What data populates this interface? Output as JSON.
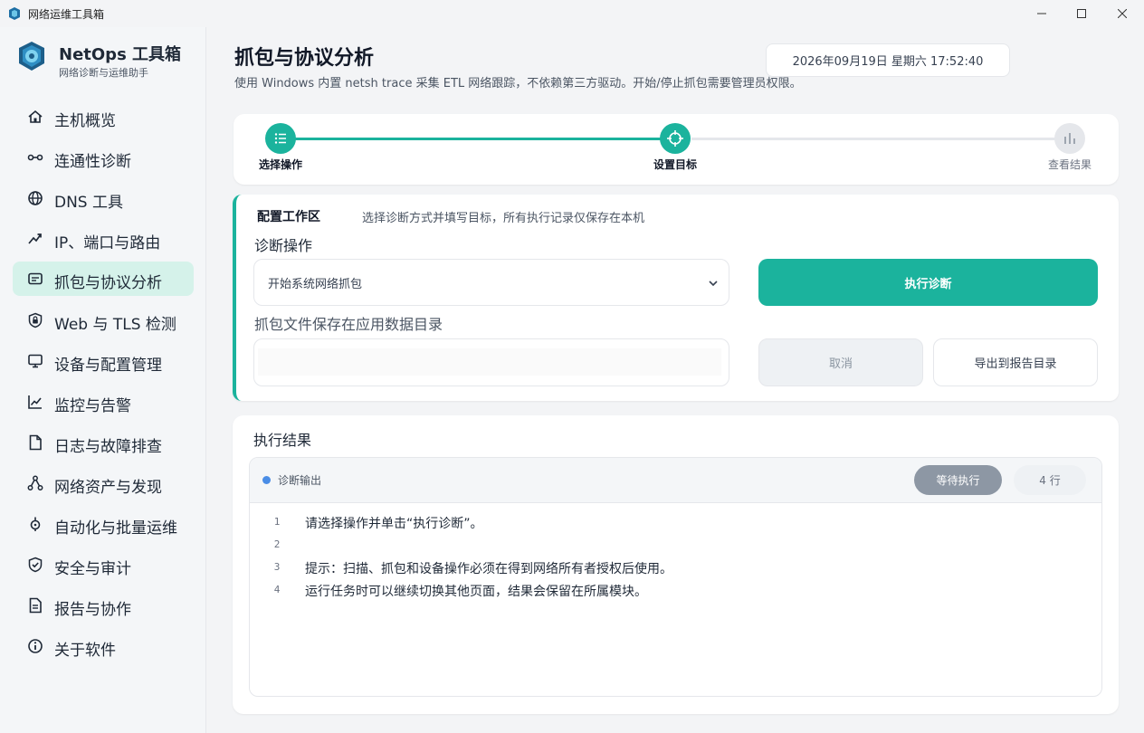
{
  "window": {
    "title": "网络运维工具箱"
  },
  "brand": {
    "name": "NetOps 工具箱",
    "subtitle": "网络诊断与运维助手"
  },
  "sidebar": {
    "items": [
      {
        "label": "主机概览",
        "icon": "home-icon"
      },
      {
        "label": "连通性诊断",
        "icon": "link-icon"
      },
      {
        "label": "DNS 工具",
        "icon": "globe-icon"
      },
      {
        "label": "IP、端口与路由",
        "icon": "route-icon"
      },
      {
        "label": "抓包与协议分析",
        "icon": "packet-icon",
        "active": true
      },
      {
        "label": "Web 与 TLS 检测",
        "icon": "lock-shield-icon"
      },
      {
        "label": "设备与配置管理",
        "icon": "monitor-icon"
      },
      {
        "label": "监控与告警",
        "icon": "line-chart-icon"
      },
      {
        "label": "日志与故障排查",
        "icon": "document-icon"
      },
      {
        "label": "网络资产与发现",
        "icon": "network-nodes-icon"
      },
      {
        "label": "自动化与批量运维",
        "icon": "automation-icon"
      },
      {
        "label": "安全与审计",
        "icon": "shield-check-icon"
      },
      {
        "label": "报告与协作",
        "icon": "report-icon"
      },
      {
        "label": "关于软件",
        "icon": "info-icon"
      }
    ]
  },
  "header": {
    "title": "抓包与协议分析",
    "description": "使用 Windows 内置 netsh trace 采集 ETL 网络跟踪，不依赖第三方驱动。开始/停止抓包需要管理员权限。",
    "datetime": "2026年09月19日  星期六  17:52:40"
  },
  "stepper": {
    "steps": [
      {
        "label": "选择操作",
        "state": "done"
      },
      {
        "label": "设置目标",
        "state": "current"
      },
      {
        "label": "查看结果",
        "state": "pending"
      }
    ]
  },
  "config": {
    "title": "配置工作区",
    "hint": "选择诊断方式并填写目标，所有执行记录仅保存在本机",
    "operation_label": "诊断操作",
    "operation_value": "开始系统网络抓包",
    "target_label": "抓包文件保存在应用数据目录",
    "target_value": "",
    "run_label": "执行诊断",
    "cancel_label": "取消",
    "export_label": "导出到报告目录"
  },
  "result": {
    "title": "执行结果",
    "output_label": "诊断输出",
    "status_badge": "等待执行",
    "line_count": "4 行",
    "lines": [
      {
        "n": "1",
        "text": "请选择操作并单击“执行诊断”。"
      },
      {
        "n": "2",
        "text": ""
      },
      {
        "n": "3",
        "text": "提示：扫描、抓包和设备操作必须在得到网络所有者授权后使用。"
      },
      {
        "n": "4",
        "text": "运行任务时可以继续切换其他页面，结果会保留在所属模块。"
      }
    ]
  },
  "colors": {
    "accent": "#1bb39d",
    "active_nav_bg": "#d5f2ea",
    "status_dot": "#4a8de6",
    "badge_wait": "#8d97a4"
  }
}
